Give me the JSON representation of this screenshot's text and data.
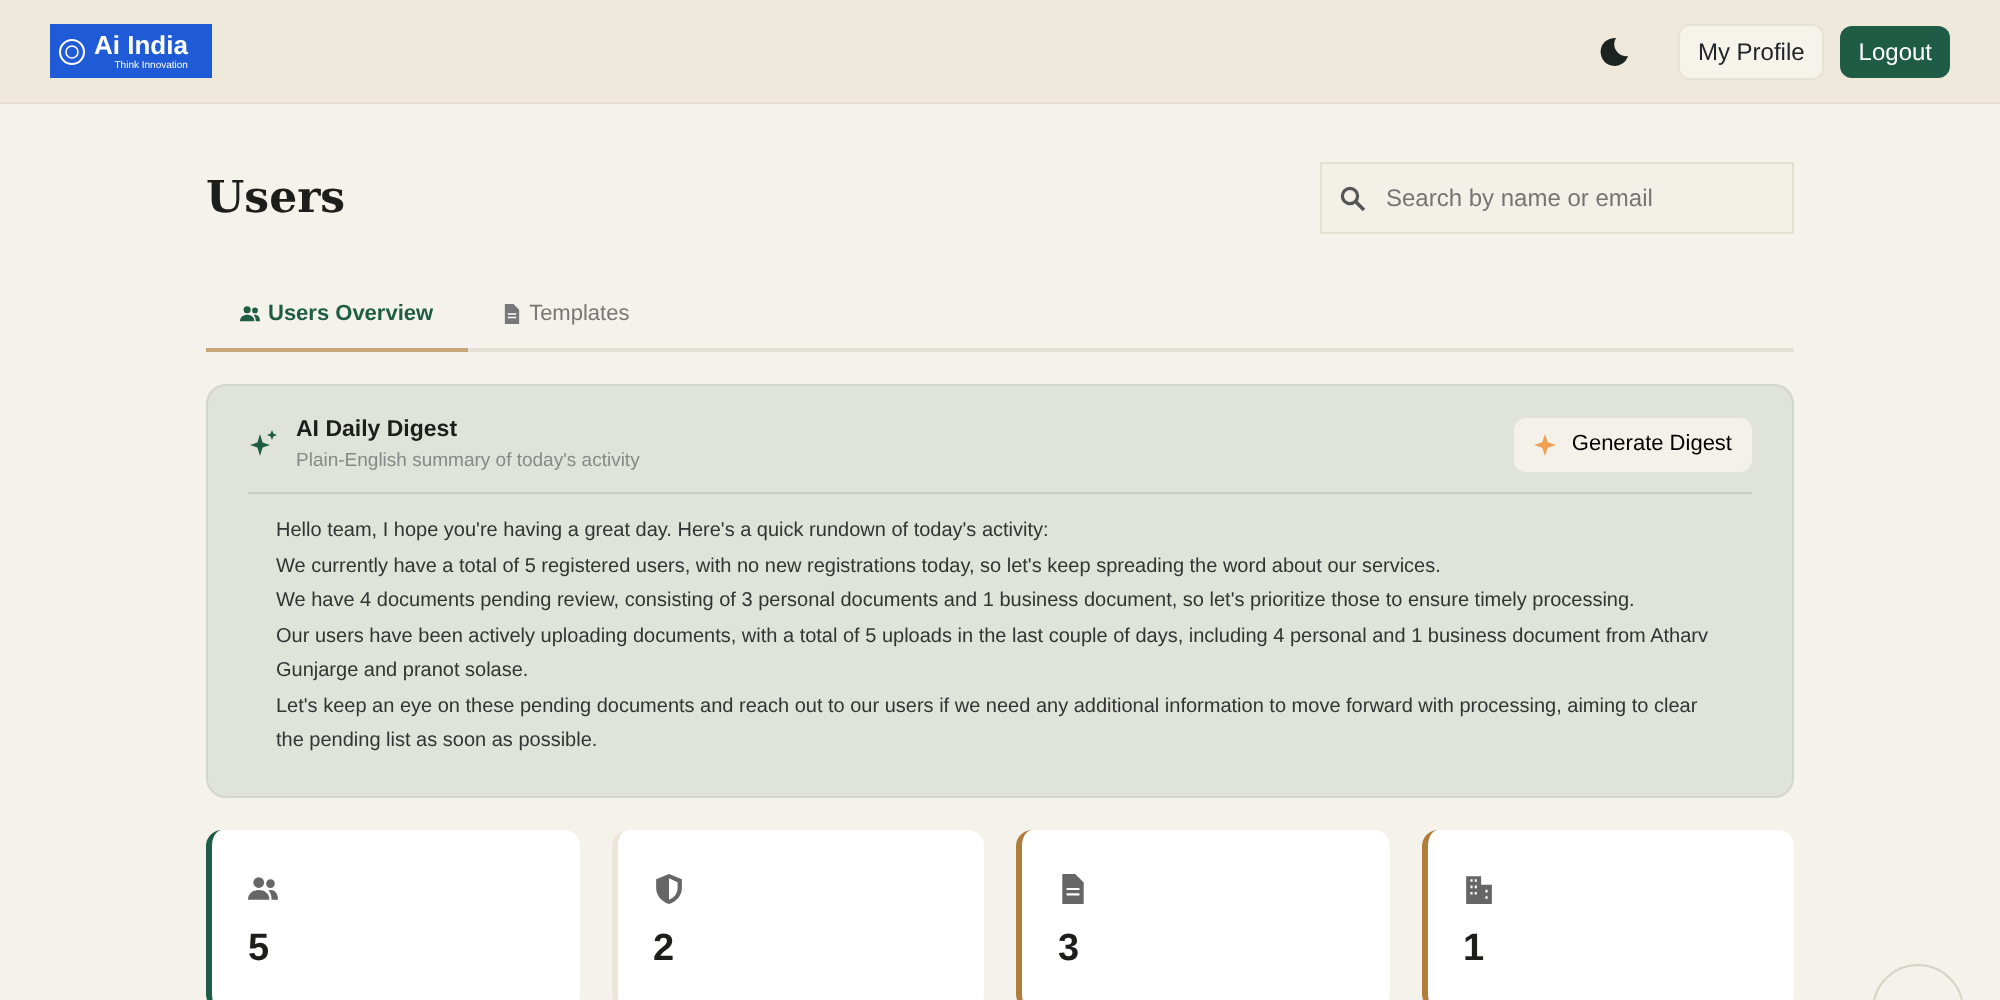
{
  "header": {
    "logo": {
      "title": "Ai India",
      "tagline": "Think Innovation"
    },
    "my_profile": "My Profile",
    "logout": "Logout"
  },
  "page": {
    "title": "Users",
    "search": {
      "placeholder": "Search by name or email"
    }
  },
  "tabs": [
    {
      "label": "Users Overview",
      "kind": "users",
      "selected": true
    },
    {
      "label": "Templates",
      "kind": "document",
      "selected": false
    }
  ],
  "digest": {
    "title": "AI Daily Digest",
    "subtitle": "Plain-English summary of today's activity",
    "button": "Generate Digest",
    "paragraphs": [
      "Hello team, I hope you're having a great day. Here's a quick rundown of today's activity:",
      "We currently have a total of 5 registered users, with no new registrations today, so let's keep spreading the word about our services.",
      "We have 4 documents pending review, consisting of 3 personal documents and 1 business document, so let's prioritize those to ensure timely processing.",
      "Our users have been actively uploading documents, with a total of 5 uploads in the last couple of days, including 4 personal and 1 business document from Atharv Gunjarge and pranot solase.",
      "Let's keep an eye on these pending documents and reach out to our users if we need any additional information to move forward with processing, aiming to clear the pending list as soon as possible."
    ]
  },
  "stats": [
    {
      "kind": "users",
      "value": "5",
      "color": "#1f5c45"
    },
    {
      "kind": "shield",
      "value": "2",
      "color": "#ece6da"
    },
    {
      "kind": "document",
      "value": "3",
      "color": "#b07d3c"
    },
    {
      "kind": "building",
      "value": "1",
      "color": "#b07d3c"
    }
  ]
}
